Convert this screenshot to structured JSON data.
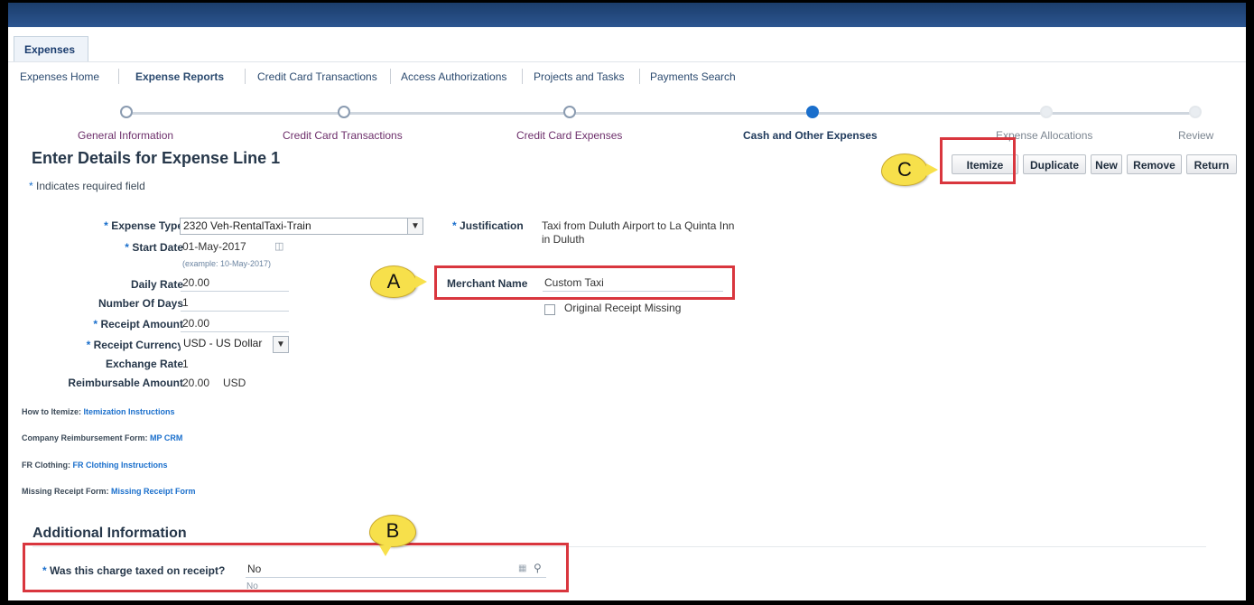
{
  "app": {
    "tab": "Expenses"
  },
  "subnav": {
    "items": [
      "Expenses Home",
      "Expense Reports",
      "Credit Card Transactions",
      "Access Authorizations",
      "Projects and Tasks",
      "Payments Search"
    ]
  },
  "train": {
    "steps": [
      "General Information",
      "Credit Card Transactions",
      "Credit Card Expenses",
      "Cash and Other Expenses",
      "Expense Allocations",
      "Review"
    ]
  },
  "page": {
    "title": "Enter Details for Expense Line 1",
    "required_note": "Indicates required field"
  },
  "buttons": {
    "itemize": "Itemize",
    "duplicate": "Duplicate",
    "new": "New",
    "remove": "Remove",
    "return": "Return"
  },
  "form": {
    "expense_type_label": "Expense Type",
    "expense_type_value": "2320 Veh-RentalTaxi-Train",
    "start_date_label": "Start Date",
    "start_date_value": "01-May-2017",
    "start_date_hint": "(example: 10-May-2017)",
    "daily_rate_label": "Daily Rate",
    "daily_rate_value": "20.00",
    "num_days_label": "Number Of Days",
    "num_days_value": "1",
    "receipt_amount_label": "Receipt Amount",
    "receipt_amount_value": "20.00",
    "receipt_currency_label": "Receipt Currency",
    "receipt_currency_value": "USD - US Dollar",
    "exchange_rate_label": "Exchange Rate",
    "exchange_rate_value": "1",
    "reimbursable_label": "Reimbursable Amount",
    "reimbursable_value": "20.00",
    "reimbursable_currency": "USD",
    "justification_label": "Justification",
    "justification_line1": "Taxi from Duluth Airport to La Quinta Inn",
    "justification_line2": "in Duluth",
    "merchant_label": "Merchant Name",
    "merchant_value": "Custom Taxi",
    "receipt_missing_label": "Original Receipt Missing"
  },
  "links": {
    "itemize_label": "How to Itemize:",
    "itemize_link": "Itemization Instructions",
    "reimb_label": "Company Reimbursement Form:",
    "reimb_link": "MP CRM",
    "fr_label": "FR Clothing:",
    "fr_link": "FR Clothing Instructions",
    "missing_label": "Missing Receipt Form:",
    "missing_link": "Missing Receipt Form"
  },
  "additional": {
    "title": "Additional Information",
    "taxed_label": "Was this charge taxed on receipt?",
    "taxed_value": "No",
    "taxed_desc": "No"
  },
  "callouts": {
    "a": "A",
    "b": "B",
    "c": "C"
  },
  "colors": {
    "accent": "#1a6fcc",
    "highlight": "#d9363e",
    "callout": "#f7e04b",
    "header": "#1b3d6b"
  }
}
